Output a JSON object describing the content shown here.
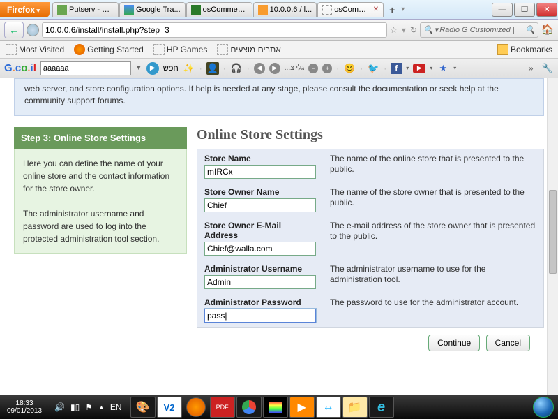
{
  "window": {
    "firefox_button": "Firefox",
    "tabs": [
      {
        "label": "Putserv - C..."
      },
      {
        "label": "Google Tra..."
      },
      {
        "label": "osCommerc..."
      },
      {
        "label": "10.0.0.6 / l..."
      },
      {
        "label": "osComm..."
      }
    ],
    "win_min": "—",
    "win_max": "❐",
    "win_close": "✕"
  },
  "url": {
    "address": "10.0.0.6/install/install.php?step=3",
    "search_placeholder": "Radio G Customized |"
  },
  "bookmarks": {
    "most_visited": "Most Visited",
    "getting_started": "Getting Started",
    "hp_games": "HP Games",
    "suggested": "אתרים מוצעים",
    "bookmarks_label": "Bookmarks"
  },
  "toolbar": {
    "search_value": "aaaaaa",
    "search_button": "חפש",
    "radio_label": "...גלי צ"
  },
  "page": {
    "banner": "web server, and store configuration options. If help is needed at any stage, please consult the documentation or seek help at the community support forums.",
    "step_title": "Step 3: Online Store Settings",
    "sidebar_p1": "Here you can define the name of your online store and the contact information for the store owner.",
    "sidebar_p2": "The administrator username and password are used to log into the protected administration tool section.",
    "heading": "Online Store Settings",
    "fields": [
      {
        "label": "Store Name",
        "value": "mIRCx",
        "desc": "The name of the online store that is presented to the public."
      },
      {
        "label": "Store Owner Name",
        "value": "Chief",
        "desc": "The name of the store owner that is presented to the public."
      },
      {
        "label": "Store Owner E-Mail Address",
        "value": "Chief@walla.com",
        "desc": "The e-mail address of the store owner that is presented to the public."
      },
      {
        "label": "Administrator Username",
        "value": "Admin",
        "desc": "The administrator username to use for the administration tool."
      },
      {
        "label": "Administrator Password",
        "value": "pass|",
        "desc": "The password to use for the administrator account."
      }
    ],
    "continue": "Continue",
    "cancel": "Cancel"
  },
  "taskbar": {
    "time": "18:33",
    "date": "09/01/2013",
    "lang": "EN"
  }
}
